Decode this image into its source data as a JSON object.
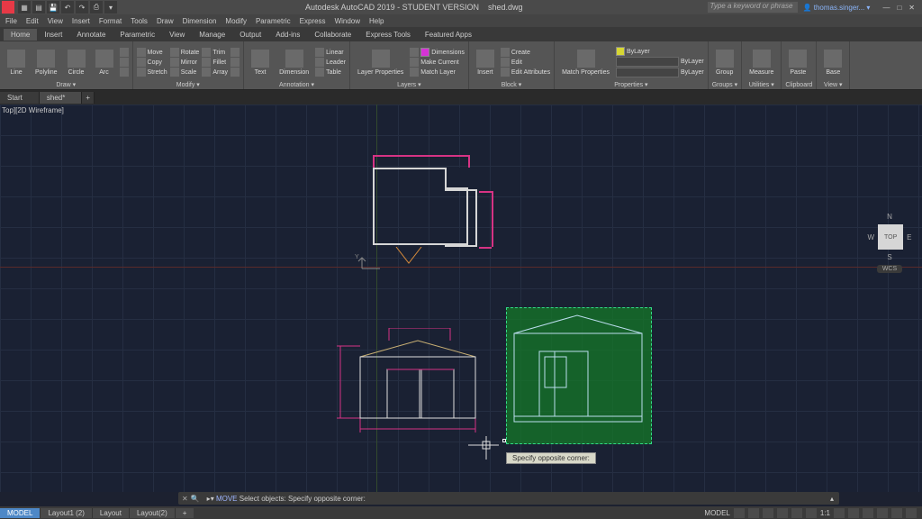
{
  "titlebar": {
    "app_title": "Autodesk AutoCAD 2019 - STUDENT VERSION",
    "file_name": "shed.dwg",
    "search_placeholder": "Type a keyword or phrase",
    "user": "thomas.singer...",
    "win_min": "—",
    "win_max": "□",
    "win_close": "✕"
  },
  "menubar": [
    "File",
    "Edit",
    "View",
    "Insert",
    "Format",
    "Tools",
    "Draw",
    "Dimension",
    "Modify",
    "Parametric",
    "Express",
    "Window",
    "Help"
  ],
  "ribbon_tabs": [
    "Home",
    "Insert",
    "Annotate",
    "Parametric",
    "View",
    "Manage",
    "Output",
    "Add-ins",
    "Collaborate",
    "Express Tools",
    "Featured Apps"
  ],
  "ribbon_active_tab": "Home",
  "ribbon": {
    "draw": {
      "title": "Draw ▾",
      "line": "Line",
      "polyline": "Polyline",
      "circle": "Circle",
      "arc": "Arc"
    },
    "modify": {
      "title": "Modify ▾",
      "move": "Move",
      "copy": "Copy",
      "stretch": "Stretch",
      "rotate": "Rotate",
      "mirror": "Mirror",
      "scale": "Scale",
      "trim": "Trim",
      "fillet": "Fillet",
      "array": "Array"
    },
    "annotation": {
      "title": "Annotation ▾",
      "text": "Text",
      "dimension": "Dimension",
      "linear": "Linear",
      "leader": "Leader",
      "table": "Table"
    },
    "layers": {
      "title": "Layers ▾",
      "layer_props": "Layer Properties",
      "dimensions": "Dimensions",
      "make_current": "Make Current",
      "match_layer": "Match Layer"
    },
    "block": {
      "title": "Block ▾",
      "insert": "Insert",
      "create": "Create",
      "edit": "Edit",
      "edit_attrs": "Edit Attributes"
    },
    "properties": {
      "title": "Properties ▾",
      "match": "Match Properties",
      "bylayer": "ByLayer"
    },
    "groups": {
      "title": "Groups ▾",
      "group": "Group"
    },
    "utilities": {
      "title": "Utilities ▾",
      "measure": "Measure"
    },
    "clipboard": {
      "title": "Clipboard",
      "paste": "Paste"
    },
    "view": {
      "title": "View ▾",
      "base": "Base"
    }
  },
  "filetabs": {
    "start": "Start",
    "shed": "shed*"
  },
  "viewport_label": "Top][2D Wireframe]",
  "viewcube": {
    "n": "N",
    "s": "S",
    "e": "E",
    "w": "W",
    "top": "TOP",
    "wcs": "WCS"
  },
  "tooltip": "Specify opposite corner:",
  "commandline": {
    "command": "MOVE",
    "prompt": "Select objects: Specify opposite corner:",
    "chevron": "▸▾",
    "close": "✕",
    "search": "🔍"
  },
  "statusbar": {
    "model": "MODEL",
    "layout1": "Layout1 (2)",
    "layout2": "Layout",
    "layout3": "Layout(2)",
    "right_model": "MODEL",
    "scale": "1:1",
    "plus": "+"
  },
  "colors": {
    "dim": "#d63384",
    "brand": "#1c2130",
    "select": "#11772f"
  }
}
